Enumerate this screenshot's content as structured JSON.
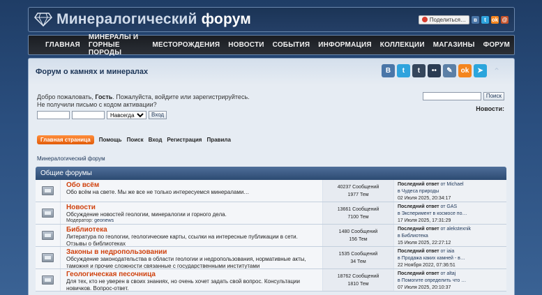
{
  "header": {
    "logo_word1": "Минералогический",
    "logo_word2": "форум",
    "share_label": "Поделиться…"
  },
  "nav": [
    "ГЛАВНАЯ",
    "МИНЕРАЛЫ И ГОРНЫЕ ПОРОДЫ",
    "МЕСТОРОЖДЕНИЯ",
    "НОВОСТИ",
    "СОБЫТИЯ",
    "ИНФОРМАЦИЯ",
    "КОЛЛЕКЦИИ",
    "МАГАЗИНЫ",
    "ФОРУМ"
  ],
  "forum_title": "Форум о камнях и минералах",
  "socials": [
    {
      "icon": "vk-icon",
      "glyph": "В",
      "color": "#4a76a8"
    },
    {
      "icon": "twitter-icon",
      "glyph": "t",
      "color": "#2fa3dd"
    },
    {
      "icon": "tumblr-icon",
      "glyph": "t",
      "color": "#35465c"
    },
    {
      "icon": "flickr-icon",
      "glyph": "••",
      "color": "#2a3b52"
    },
    {
      "icon": "livejournal-icon",
      "glyph": "✎",
      "color": "#5b7fa6"
    },
    {
      "icon": "odnoklassniki-icon",
      "glyph": "ok",
      "color": "#f4851e"
    },
    {
      "icon": "telegram-icon",
      "glyph": "➤",
      "color": "#2ba5dc"
    }
  ],
  "login": {
    "welcome_prefix": "Добро пожаловать,",
    "guest": "Гость",
    "welcome_suffix": ". Пожалуйста, войдите или зарегистрируйтесь.",
    "activation": "Не получили письмо с кодом активации?",
    "duration_selected": "Навсегда",
    "login_button": "Вход"
  },
  "search": {
    "button": "Поиск"
  },
  "news_label": "Новости:",
  "tabs": [
    "Главная страница",
    "Помощь",
    "Поиск",
    "Вход",
    "Регистрация",
    "Правила"
  ],
  "breadcrumb": "Минералогический форум",
  "category": "Общие форумы",
  "forums": [
    {
      "name": "Обо всём",
      "desc": "Обо всём на свете. Мы же все не только интересуемся минералами…",
      "moderator_label": "",
      "moderator": "",
      "posts": "40237 Сообщений",
      "topics": "1977 Тем",
      "last_prefix": "Последний ответ",
      "last_by": "от Michael",
      "last_in": "в Чудеса природы",
      "last_date": "02 Июля 2025, 20:34:17"
    },
    {
      "name": "Новости",
      "desc": "Обсуждение новостей геологии, минералогии и горного дела.",
      "moderator_label": "Модератор:",
      "moderator": "geonews",
      "posts": "13661 Сообщений",
      "topics": "7100 Тем",
      "last_prefix": "Последний ответ",
      "last_by": "от GAS",
      "last_in": "в Эксперимент в космосе по…",
      "last_date": "17 Июля 2025, 17:31:29"
    },
    {
      "name": "Библиотека",
      "desc": "Литература по геологии, геологические карты, ссылки на интересные публикации в сети. Отзывы о библиотеках",
      "moderator_label": "",
      "moderator": "",
      "posts": "1480 Сообщений",
      "topics": "156 Тем",
      "last_prefix": "Последний ответ",
      "last_by": "от alekstexnik",
      "last_in": "в Библиотека",
      "last_date": "15 Июля 2025, 22:27:12"
    },
    {
      "name": "Законы в недропользовании",
      "desc": "Обсуждение законодательства в области геологии и недропользования, нормативные акты, таможня и прочие сложности связанные с государственными институтами",
      "moderator_label": "",
      "moderator": "",
      "posts": "1535 Сообщений",
      "topics": "34 Тем",
      "last_prefix": "Последний ответ",
      "last_by": "от iaia",
      "last_in": "в Продажа каких камней - в…",
      "last_date": "22 Ноября 2022, 07:36:51"
    },
    {
      "name": "Геологическая песочница",
      "desc": "Для тех, кто не уверен в своих знаниях, но очень хочет задать свой вопрос. Консультации новичков. Вопрос-ответ.",
      "moderator_label": "",
      "moderator": "",
      "posts": "18762 Сообщений",
      "topics": "1810 Тем",
      "last_prefix": "Последний ответ",
      "last_by": "от altaj",
      "last_in": "в Помогите определить что …",
      "last_date": "07 Июля 2025, 20:10:37"
    }
  ]
}
